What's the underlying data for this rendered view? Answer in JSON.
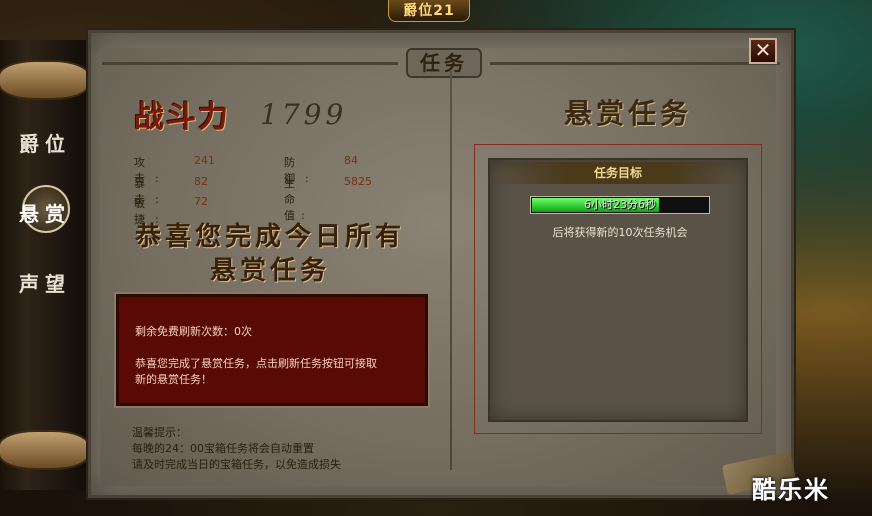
{
  "top_badge": "爵位21",
  "panel": {
    "title": "任务",
    "close": "✕"
  },
  "sidebar": {
    "items": [
      {
        "label": "爵位"
      },
      {
        "label": "悬赏"
      },
      {
        "label": "声望"
      }
    ],
    "active": "悬赏"
  },
  "left": {
    "power_label": "战斗力",
    "power_value": "1799",
    "stats": [
      {
        "label": "攻击:",
        "value": "241"
      },
      {
        "label": "防御:",
        "value": "84"
      },
      {
        "label": "暴击:",
        "value": "82"
      },
      {
        "label": "生命值:",
        "value": "5825"
      },
      {
        "label": "敏捷:",
        "value": "72"
      }
    ],
    "congrats_line1": "恭喜您完成今日所有",
    "congrats_line2": "悬赏任务",
    "msg_refresh": "剩余免费刷新次数：0次",
    "msg_body_1": "恭喜您完成了悬赏任务，点击刷新任务按钮可接取",
    "msg_body_2": "新的悬赏任务！",
    "tips_title": "温馨提示：",
    "tips_1": "每晚的24：00宝箱任务将会自动重置",
    "tips_2": "请及时完成当日的宝箱任务，以免造成损失"
  },
  "right": {
    "title": "悬赏任务",
    "objective_header": "任务目标",
    "timer_text": "6小时23分6秒",
    "timer_progress": 0.72,
    "timer_sub": "后将获得新的10次任务机会"
  },
  "watermark": "酷乐米",
  "colors": {
    "accent_gold": "#ffd77a",
    "msg_bg": "#5a0a04",
    "progress": "#12a012"
  }
}
